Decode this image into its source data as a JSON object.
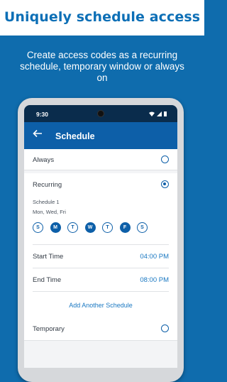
{
  "headline": "Uniquely schedule access",
  "subtitle": "Create access codes as a recurring schedule, temporary window or always on",
  "status_bar": {
    "time": "9:30"
  },
  "app_bar": {
    "title": "Schedule"
  },
  "options": {
    "always": {
      "label": "Always",
      "selected": false
    },
    "recurring": {
      "label": "Recurring",
      "selected": true
    },
    "temporary": {
      "label": "Temporary",
      "selected": false
    }
  },
  "schedule": {
    "title": "Schedule 1",
    "days_summary": "Mon, Wed, Fri",
    "days": [
      {
        "letter": "S",
        "selected": false
      },
      {
        "letter": "M",
        "selected": true
      },
      {
        "letter": "T",
        "selected": false
      },
      {
        "letter": "W",
        "selected": true
      },
      {
        "letter": "T",
        "selected": false
      },
      {
        "letter": "F",
        "selected": true
      },
      {
        "letter": "S",
        "selected": false
      }
    ],
    "start_time_label": "Start Time",
    "start_time": "04:00 PM",
    "end_time_label": "End Time",
    "end_time": "08:00 PM",
    "add_label": "Add Another Schedule"
  },
  "colors": {
    "background": "#0f6cad",
    "accent": "#0d5fa8",
    "status_bar": "#0a2c4c"
  },
  "icons": {
    "back": "arrow-left-icon",
    "wifi": "wifi-icon",
    "signal": "signal-icon",
    "battery": "battery-icon"
  }
}
